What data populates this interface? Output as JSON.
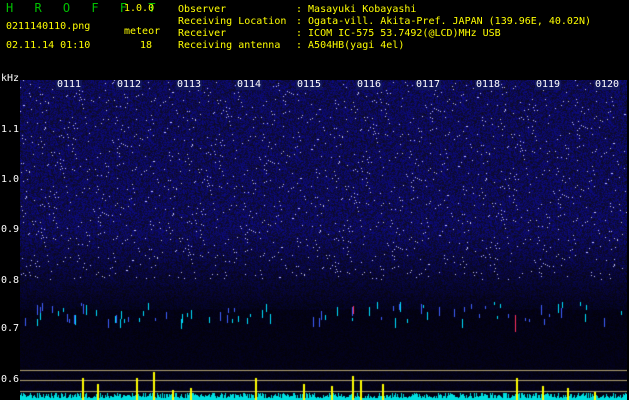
{
  "header": {
    "brand": "H R O F F T",
    "version": "1.0.0",
    "filename": "0211140110.png",
    "datetime": "02.11.14 01:10",
    "meteor_label": "meteor",
    "meteor_count": "18"
  },
  "info": [
    {
      "key": "Observer",
      "value": ": Masayuki Kobayashi"
    },
    {
      "key": "Receiving Location",
      "value": ": Ogata-vill. Akita-Pref. JAPAN (139.96E, 40.02N)"
    },
    {
      "key": "Receiver",
      "value": ": ICOM IC-575 53.7492(@LCD)MHz USB"
    },
    {
      "key": "Receiving antenna",
      "value": ": A504HB(yagi 4el)"
    }
  ],
  "axis": {
    "y_unit": "kHz",
    "y_ticks": [
      "1.1",
      "1.0",
      "0.9",
      "0.8",
      "0.7",
      "0.6"
    ],
    "x_ticks": [
      "0111",
      "0112",
      "0113",
      "0114",
      "0115",
      "0116",
      "0117",
      "0118",
      "0119",
      "0120"
    ]
  },
  "colors": {
    "background": "#000000",
    "spectrum_noise": "#1a1f9a",
    "meteor_echo": "#00ffff",
    "label_yellow": "#ffff00",
    "brand_green": "#00c000"
  }
}
